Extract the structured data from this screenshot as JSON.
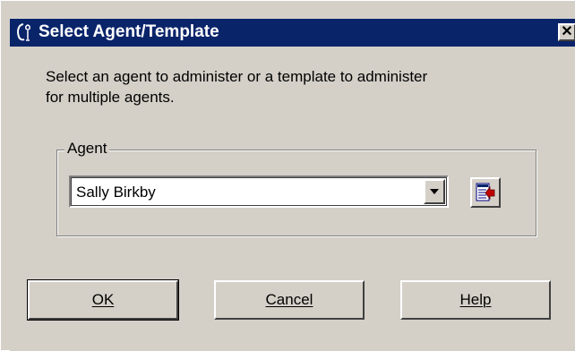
{
  "window": {
    "title": "Select Agent/Template",
    "close_glyph": "✕"
  },
  "dialog": {
    "instructions": "Select an agent to administer or a template to administer\nfor multiple agents.",
    "group_label": "Agent",
    "agent_select": {
      "value": "Sally Birkby"
    }
  },
  "buttons": {
    "ok": "OK",
    "cancel": "Cancel",
    "help": "Help"
  },
  "icons": {
    "title": "app-icon",
    "dropdown": "chevron-down-icon",
    "select": "select-from-list-icon"
  },
  "colors": {
    "title_bar": "#0a246a",
    "face": "#d4d0c8"
  }
}
